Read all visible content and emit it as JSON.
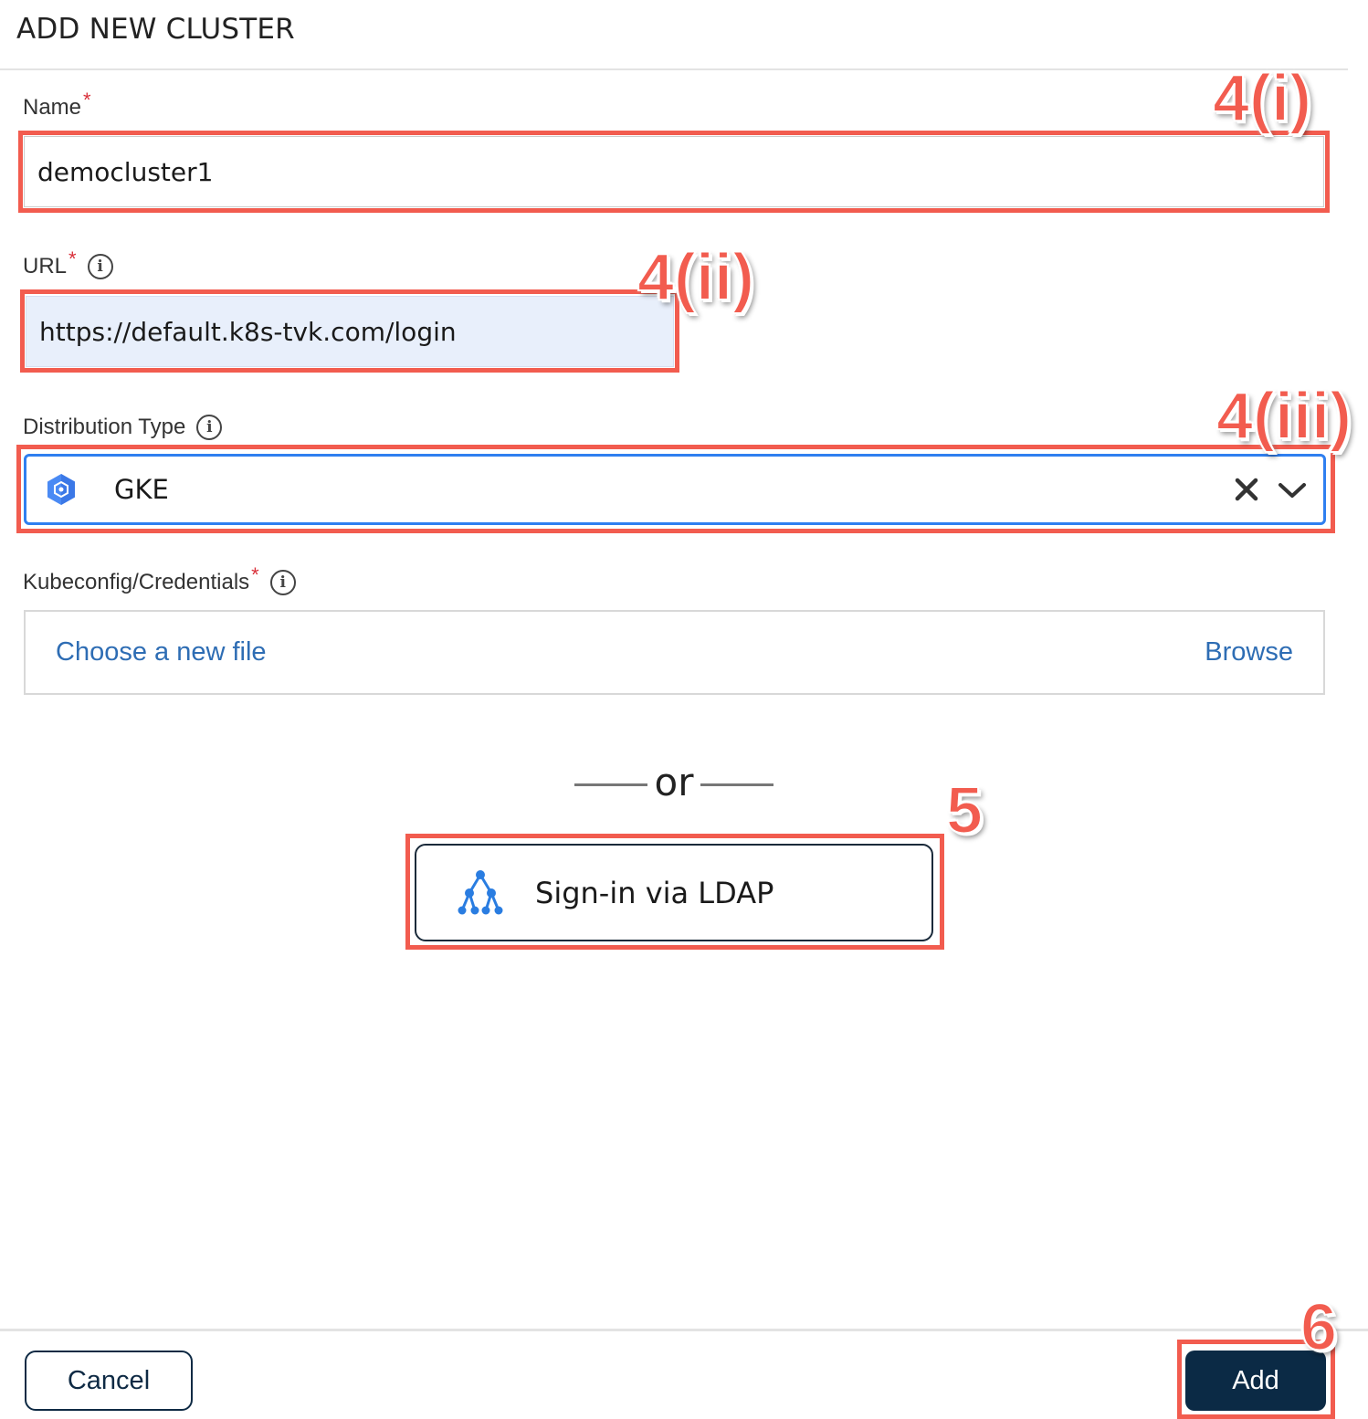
{
  "dialog": {
    "title": "ADD NEW CLUSTER"
  },
  "form": {
    "name": {
      "label": "Name",
      "required_mark": "*",
      "value": "democluster1"
    },
    "url": {
      "label": "URL",
      "required_mark": "*",
      "value": "https://default.k8s-tvk.com/login",
      "info_icon": "info-icon"
    },
    "distribution": {
      "label": "Distribution Type",
      "selected_value": "GKE",
      "value_icon": "gke-hexagon-icon",
      "info_icon": "info-icon"
    },
    "kubeconfig": {
      "label": "Kubeconfig/Credentials",
      "required_mark": "*",
      "placeholder": "Choose a new file",
      "browse_label": "Browse",
      "info_icon": "info-icon"
    }
  },
  "divider": {
    "text": "or"
  },
  "ldap": {
    "label": "Sign-in via LDAP",
    "icon": "ldap-tree-icon"
  },
  "footer": {
    "cancel_label": "Cancel",
    "add_label": "Add"
  },
  "annotations": {
    "name_step": "4(i)",
    "url_step": "4(ii)",
    "distribution_step": "4(iii)",
    "ldap_step": "5",
    "add_step": "6"
  },
  "colors": {
    "accent_blue": "#2f7ff0",
    "link_blue": "#2e6db4",
    "primary_button": "#0b2a45",
    "annotation_red": "#f25c4f",
    "required_red": "#d9303a",
    "url_field_bg": "#e8effb"
  }
}
